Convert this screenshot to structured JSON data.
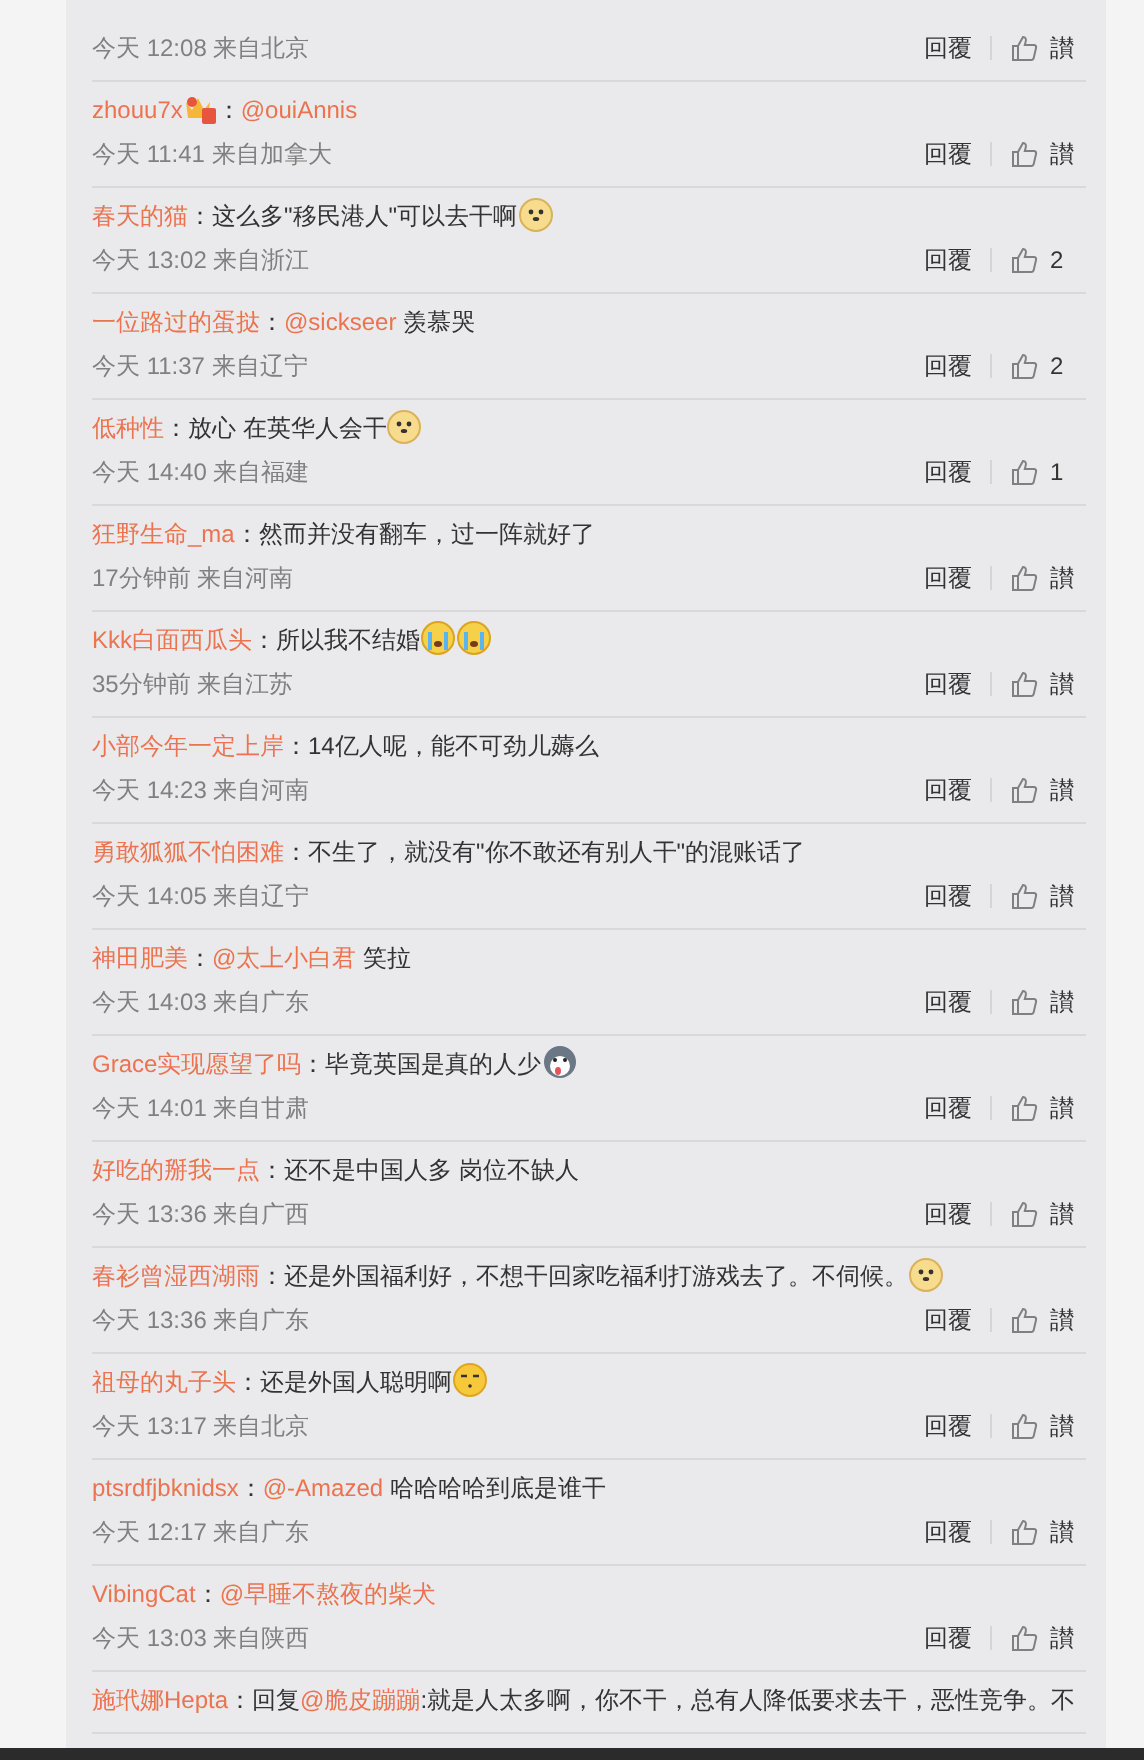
{
  "comments": [
    {
      "time": "今天 12:08 来自北京",
      "reply": "回覆",
      "like": "讃"
    },
    {
      "author": "zhouu7x",
      "badge": true,
      "separator": "：",
      "content": [
        {
          "kind": "mention",
          "text": "@ouiAnnis"
        }
      ],
      "time": "今天 11:41 来自加拿大",
      "reply": "回覆",
      "like": "讃"
    },
    {
      "author": "春天的猫",
      "badge": false,
      "separator": "：",
      "content": [
        {
          "kind": "text",
          "text": "这么多\"移民港人\"可以去干啊"
        },
        {
          "kind": "doge"
        }
      ],
      "time": "今天 13:02 来自浙江",
      "reply": "回覆",
      "like": "2"
    },
    {
      "author": "一位路过的蛋挞",
      "badge": false,
      "separator": "：",
      "content": [
        {
          "kind": "mention",
          "text": "@sickseer"
        },
        {
          "kind": "text",
          "text": " 羡慕哭"
        }
      ],
      "time": "今天 11:37 来自辽宁",
      "reply": "回覆",
      "like": "2"
    },
    {
      "author": "低种性",
      "badge": false,
      "separator": "：",
      "content": [
        {
          "kind": "text",
          "text": "放心 在英华人会干"
        },
        {
          "kind": "doge"
        }
      ],
      "time": "今天 14:40 来自福建",
      "reply": "回覆",
      "like": "1"
    },
    {
      "author": "狂野生命_ma",
      "badge": false,
      "separator": "：",
      "content": [
        {
          "kind": "text",
          "text": "然而并没有翻车，过一阵就好了"
        }
      ],
      "time": "17分钟前 来自河南",
      "reply": "回覆",
      "like": "讃"
    },
    {
      "author": "Kkk白面西瓜头",
      "badge": false,
      "separator": "：",
      "content": [
        {
          "kind": "text",
          "text": "所以我不结婚"
        },
        {
          "kind": "cry"
        },
        {
          "kind": "cry"
        }
      ],
      "time": "35分钟前 来自江苏",
      "reply": "回覆",
      "like": "讃"
    },
    {
      "author": "小部今年一定上岸",
      "badge": false,
      "separator": "：",
      "content": [
        {
          "kind": "text",
          "text": "14亿人呢，能不可劲儿薅么"
        }
      ],
      "time": "今天 14:23 来自河南",
      "reply": "回覆",
      "like": "讃"
    },
    {
      "author": "勇敢狐狐不怕困难",
      "badge": false,
      "separator": "：",
      "content": [
        {
          "kind": "text",
          "text": "不生了，就没有\"你不敢还有别人干\"的混账话了"
        }
      ],
      "time": "今天 14:05 来自辽宁",
      "reply": "回覆",
      "like": "讃"
    },
    {
      "author": "神田肥美",
      "badge": false,
      "separator": "：",
      "content": [
        {
          "kind": "mention",
          "text": "@太上小白君"
        },
        {
          "kind": "text",
          "text": " 笑拉"
        }
      ],
      "time": "今天 14:03 来自广东",
      "reply": "回覆",
      "like": "讃"
    },
    {
      "author": "Grace实现愿望了吗",
      "badge": false,
      "separator": "：",
      "content": [
        {
          "kind": "text",
          "text": "毕竟英国是真的人少"
        },
        {
          "kind": "husky"
        }
      ],
      "time": "今天 14:01 来自甘肃",
      "reply": "回覆",
      "like": "讃"
    },
    {
      "author": "好吃的掰我一点",
      "badge": false,
      "separator": "：",
      "content": [
        {
          "kind": "text",
          "text": "还不是中国人多 岗位不缺人"
        }
      ],
      "time": "今天 13:36 来自广西",
      "reply": "回覆",
      "like": "讃"
    },
    {
      "author": "春衫曾湿西湖雨",
      "badge": false,
      "separator": "：",
      "content": [
        {
          "kind": "text",
          "text": "还是外国福利好，不想干回家吃福利打游戏去了。不伺候。"
        },
        {
          "kind": "doge"
        }
      ],
      "time": "今天 13:36 来自广东",
      "reply": "回覆",
      "like": "讃"
    },
    {
      "author": "祖母的丸子头",
      "badge": false,
      "separator": "：",
      "content": [
        {
          "kind": "text",
          "text": "还是外国人聪明啊"
        },
        {
          "kind": "smirk"
        }
      ],
      "time": "今天 13:17 来自北京",
      "reply": "回覆",
      "like": "讃"
    },
    {
      "author": "ptsrdfjbknidsx",
      "badge": false,
      "separator": "：",
      "content": [
        {
          "kind": "mention",
          "text": "@-Amazed"
        },
        {
          "kind": "text",
          "text": " 哈哈哈哈到底是谁干"
        }
      ],
      "time": "今天 12:17 来自广东",
      "reply": "回覆",
      "like": "讃"
    },
    {
      "author": "VibingCat",
      "badge": false,
      "separator": "：",
      "content": [
        {
          "kind": "mention",
          "text": "@早睡不熬夜的柴犬"
        }
      ],
      "time": "今天 13:03 来自陕西",
      "reply": "回覆",
      "like": "讃"
    },
    {
      "author": "施玳娜Hepta",
      "badge": false,
      "separator": "：",
      "content": [
        {
          "kind": "text",
          "text": "回复"
        },
        {
          "kind": "mention",
          "text": "@脆皮蹦蹦"
        },
        {
          "kind": "text",
          "text": ":就是人太多啊，你不干，总有人降低要求去干，恶性竞争。不"
        }
      ]
    }
  ]
}
